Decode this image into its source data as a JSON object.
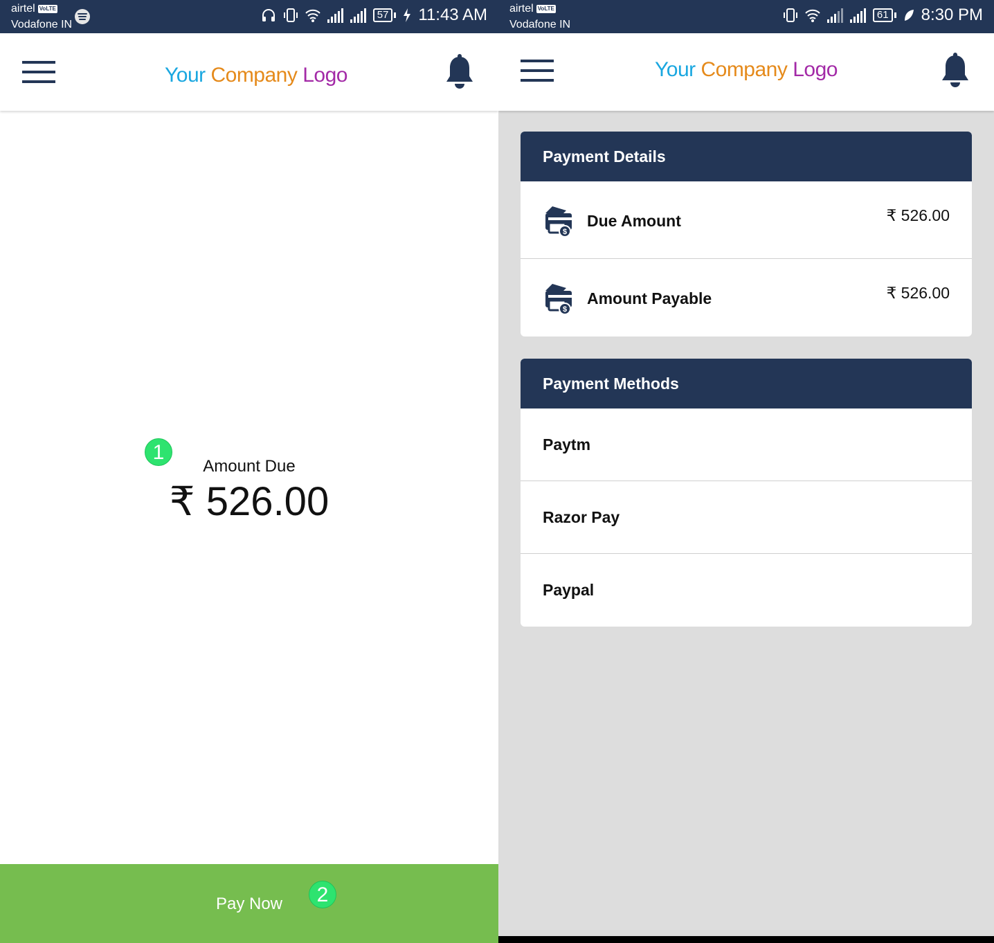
{
  "left": {
    "status": {
      "carrier1": "airtel",
      "volte": "VoLTE",
      "carrier2": "Vodafone IN",
      "battery": "57",
      "time": "11:43 AM"
    },
    "logo": {
      "w1": "Your",
      "w2": "Company",
      "w3": "Logo"
    },
    "marker1": "1",
    "marker2": "2",
    "amount_label": "Amount Due",
    "amount_value": "₹ 526.00",
    "pay_button": "Pay Now"
  },
  "right": {
    "status": {
      "carrier1": "airtel",
      "volte": "VoLTE",
      "carrier2": "Vodafone IN",
      "battery": "61",
      "time": "8:30 PM"
    },
    "logo": {
      "w1": "Your",
      "w2": "Company",
      "w3": "Logo"
    },
    "payment_details": {
      "title": "Payment Details",
      "rows": [
        {
          "label": "Due Amount",
          "value": "₹ 526.00",
          "icon": "card-payment-icon"
        },
        {
          "label": "Amount Payable",
          "value": "₹ 526.00",
          "icon": "card-payment-icon"
        }
      ]
    },
    "payment_methods": {
      "title": "Payment Methods",
      "items": [
        "Paytm",
        "Razor Pay",
        "Paypal"
      ]
    }
  },
  "colors": {
    "status_bar": "#233656",
    "card_header": "#233656",
    "pay_button": "#76bd4f",
    "marker": "#2ee36f",
    "logo_your": "#1aa7e0",
    "logo_company": "#e58a1b",
    "logo_logo": "#a32aa7",
    "right_background": "#dddddd"
  }
}
